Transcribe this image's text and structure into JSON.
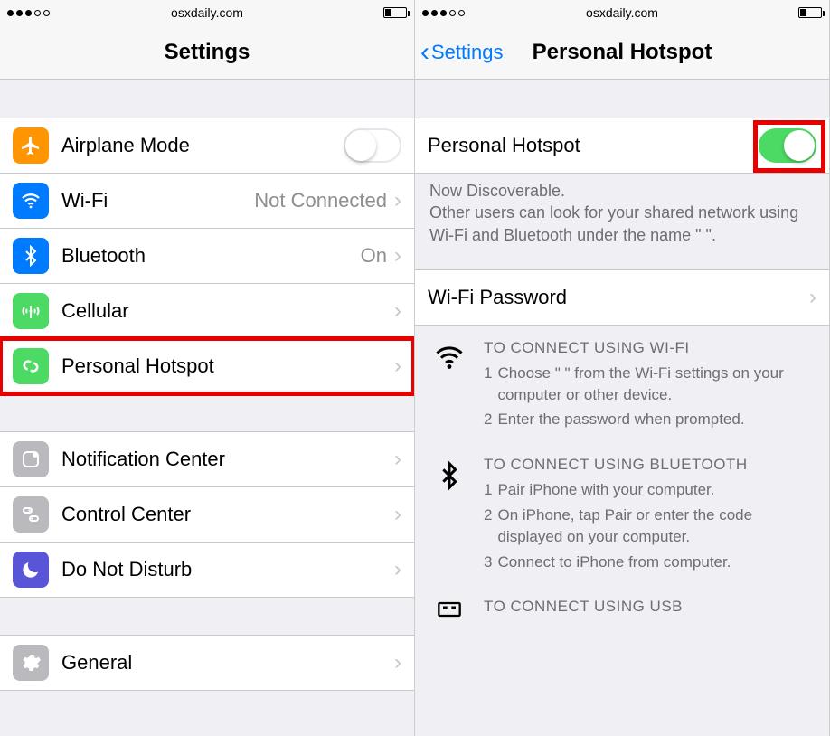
{
  "statusbar": {
    "site": "osxdaily.com"
  },
  "left": {
    "title": "Settings",
    "rows": [
      {
        "icon": "airplane-icon",
        "bg": "bg-orange",
        "label": "Airplane Mode",
        "value": "",
        "toggle": "off"
      },
      {
        "icon": "wifi-icon",
        "bg": "bg-blue",
        "label": "Wi-Fi",
        "value": "Not Connected",
        "disclosure": true
      },
      {
        "icon": "bluetooth-icon",
        "bg": "bg-blue",
        "label": "Bluetooth",
        "value": "On",
        "disclosure": true
      },
      {
        "icon": "cellular-icon",
        "bg": "bg-green",
        "label": "Cellular",
        "value": "",
        "disclosure": true
      },
      {
        "icon": "hotspot-icon",
        "bg": "bg-green",
        "label": "Personal Hotspot",
        "value": "",
        "disclosure": true,
        "highlight": true
      }
    ],
    "rows2": [
      {
        "icon": "notif-icon",
        "bg": "bg-gray",
        "label": "Notification Center",
        "value": "",
        "disclosure": true
      },
      {
        "icon": "control-icon",
        "bg": "bg-gray",
        "label": "Control Center",
        "value": "",
        "disclosure": true
      },
      {
        "icon": "moon-icon",
        "bg": "bg-purple",
        "label": "Do Not Disturb",
        "value": "",
        "disclosure": true
      }
    ],
    "rows3": [
      {
        "icon": "gear-icon",
        "bg": "bg-gray",
        "label": "General",
        "value": "",
        "disclosure": true
      }
    ]
  },
  "right": {
    "back": "Settings",
    "title": "Personal Hotspot",
    "toggleRow": {
      "label": "Personal Hotspot",
      "on": true,
      "highlight": true
    },
    "discoverable": {
      "line1": "Now Discoverable.",
      "line2": "Other users can look for your shared network using Wi-Fi and Bluetooth under the name \"                    \"."
    },
    "wifiPassword": "Wi-Fi Password",
    "instrWifi": {
      "title": "TO CONNECT USING WI-FI",
      "steps": [
        "Choose \"                        \" from the Wi-Fi settings on your computer or other device.",
        "Enter the password when prompted."
      ]
    },
    "instrBt": {
      "title": "TO CONNECT USING BLUETOOTH",
      "steps": [
        "Pair iPhone with your computer.",
        "On iPhone, tap Pair or enter the code displayed on your computer.",
        "Connect to iPhone from computer."
      ]
    },
    "instrUsb": {
      "title": "TO CONNECT USING USB"
    }
  }
}
